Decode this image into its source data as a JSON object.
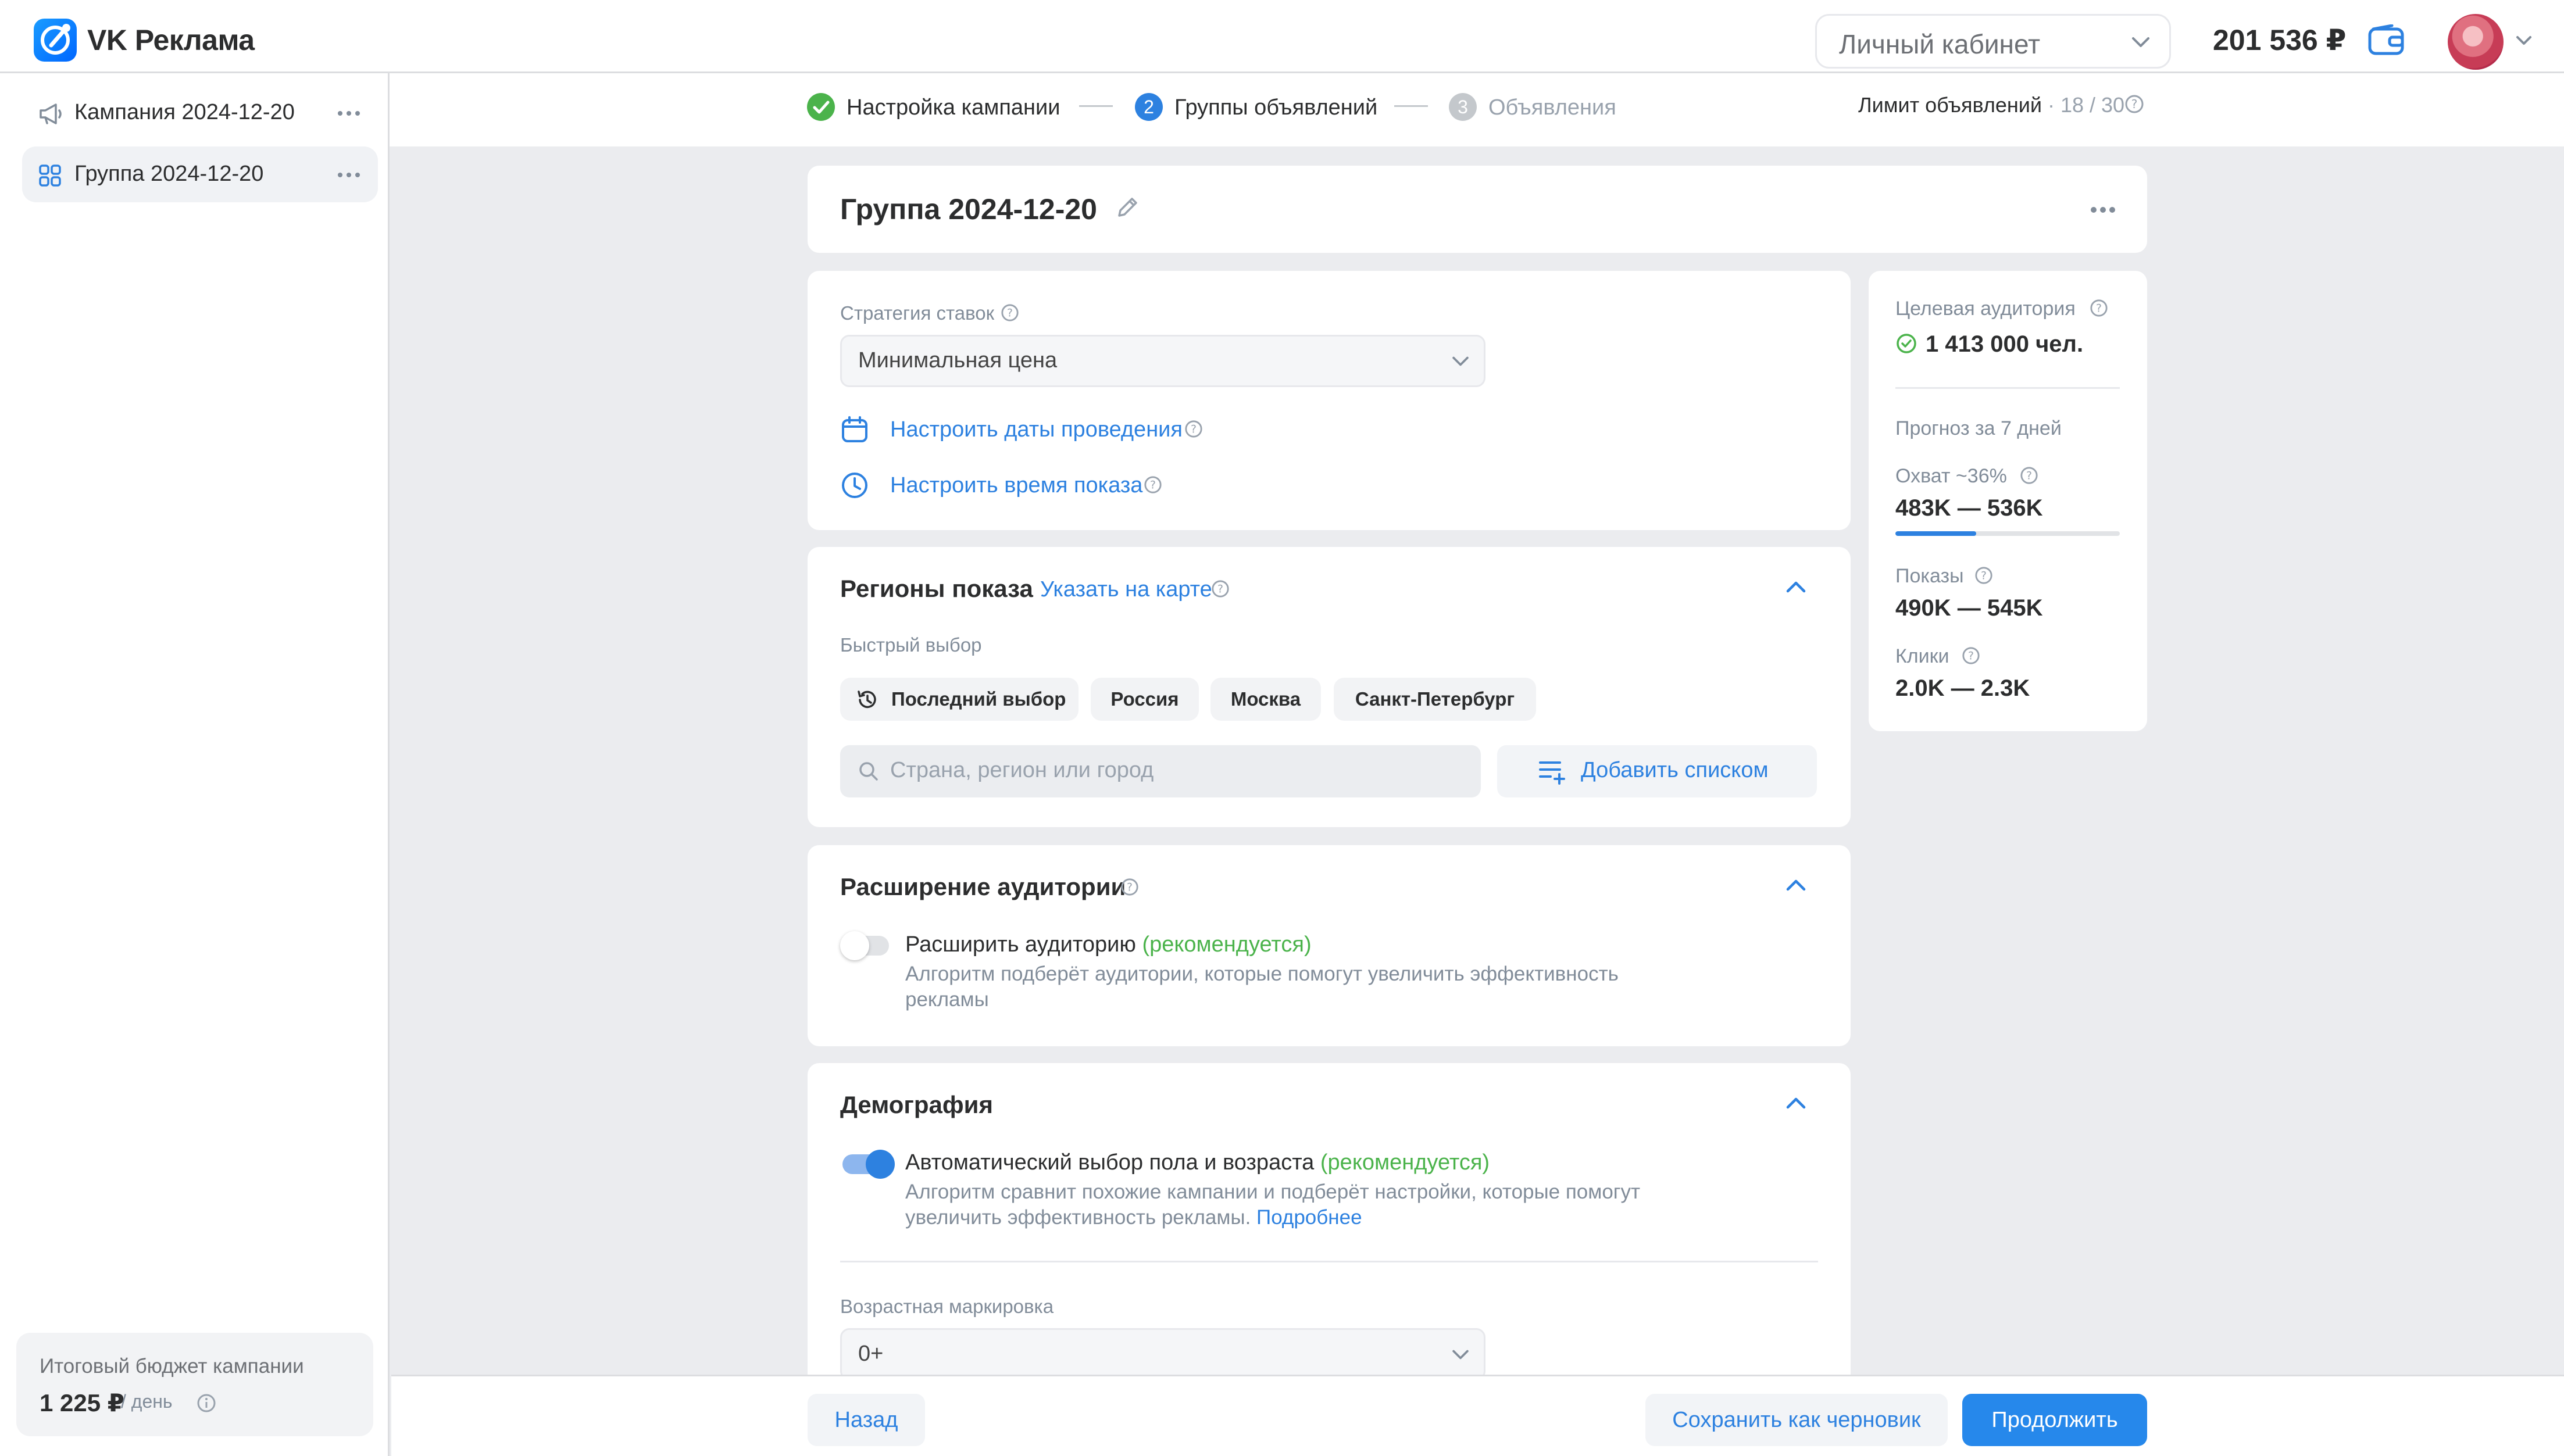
{
  "app": {
    "name": "VK Реклама"
  },
  "header": {
    "account_select": "Личный кабинет",
    "balance": "201 536 ₽"
  },
  "sidebar": {
    "items": [
      {
        "label": "Кампания 2024-12-20",
        "icon": "megaphone-icon"
      },
      {
        "label": "Группа 2024-12-20",
        "icon": "grid-icon",
        "active": true
      }
    ],
    "budget": {
      "caption": "Итоговый бюджет кампании",
      "value": "1 225 ₽",
      "period": "/ день"
    }
  },
  "stepper": {
    "steps": [
      {
        "num": "",
        "label": "Настройка кампании",
        "state": "done"
      },
      {
        "num": "2",
        "label": "Группы объявлений",
        "state": "current"
      },
      {
        "num": "3",
        "label": "Объявления",
        "state": "pending"
      }
    ],
    "limit_label": "Лимит объявлений",
    "limit_sep": "·",
    "limit_value": "18 / 30"
  },
  "group": {
    "title": "Группа 2024-12-20"
  },
  "bidding": {
    "label": "Стратегия ставок",
    "value": "Минимальная цена",
    "dates_link": "Настроить даты проведения",
    "time_link": "Настроить время показа"
  },
  "regions": {
    "title": "Регионы показа",
    "map_link": "Указать на карте",
    "quick_label": "Быстрый выбор",
    "chips": [
      "Последний выбор",
      "Россия",
      "Москва",
      "Санкт-Петербург"
    ],
    "search_placeholder": "Страна, регион или город",
    "add_list": "Добавить списком"
  },
  "expansion": {
    "title": "Расширение аудитории",
    "toggle_label": "Расширить аудиторию",
    "recommended": "(рекомендуется)",
    "toggle_on": false,
    "desc": "Алгоритм подберёт аудитории, которые помогут увеличить эффективность рекламы"
  },
  "demography": {
    "title": "Демография",
    "toggle_label": "Автоматический выбор пола и возраста",
    "recommended": "(рекомендуется)",
    "toggle_on": true,
    "desc": "Алгоритм сравнит похожие кампании и подберёт настройки, которые помогут увеличить эффективность рекламы.",
    "more": "Подробнее",
    "age_label": "Возрастная маркировка",
    "age_value": "0+"
  },
  "forecast": {
    "audience_label": "Целевая аудитория",
    "audience_value": "1 413 000 чел.",
    "forecast_label": "Прогноз за 7 дней",
    "reach_label": "Охват ~36%",
    "reach_value": "483K — 536K",
    "reach_fraction": 0.36,
    "impressions_label": "Показы",
    "impressions_value": "490K — 545K",
    "clicks_label": "Клики",
    "clicks_value": "2.0K — 2.3K"
  },
  "footer": {
    "back": "Назад",
    "save_draft": "Сохранить как черновик",
    "continue": "Продолжить"
  },
  "colors": {
    "accent": "#2d81e0",
    "recommended": "#4bb34b",
    "background": "#ebecef"
  }
}
